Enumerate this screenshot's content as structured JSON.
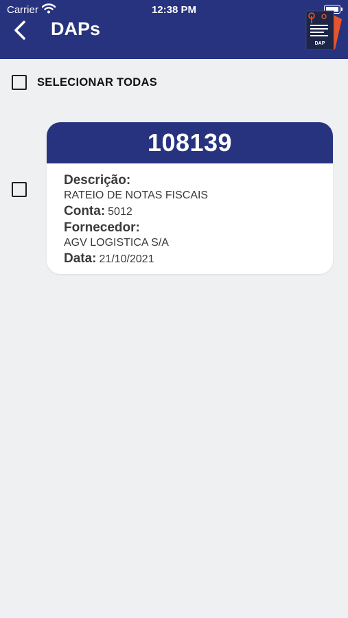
{
  "status_bar": {
    "carrier": "Carrier",
    "time": "12:38 PM"
  },
  "header": {
    "title": "DAPs",
    "logo_text": "DAP"
  },
  "select_all": {
    "label": "SELECIONAR TODAS",
    "checked": false
  },
  "items": [
    {
      "number": "108139",
      "descricao_label": "Descrição:",
      "descricao": "RATEIO DE NOTAS FISCAIS",
      "conta_label": "Conta:",
      "conta": "5012",
      "fornecedor_label": "Fornecedor:",
      "fornecedor": "AGV LOGISTICA S/A",
      "data_label": "Data:",
      "data": "21/10/2021",
      "checked": false
    }
  ],
  "colors": {
    "primary": "#283380",
    "background": "#eff0f2",
    "accent": "#e8552b"
  }
}
